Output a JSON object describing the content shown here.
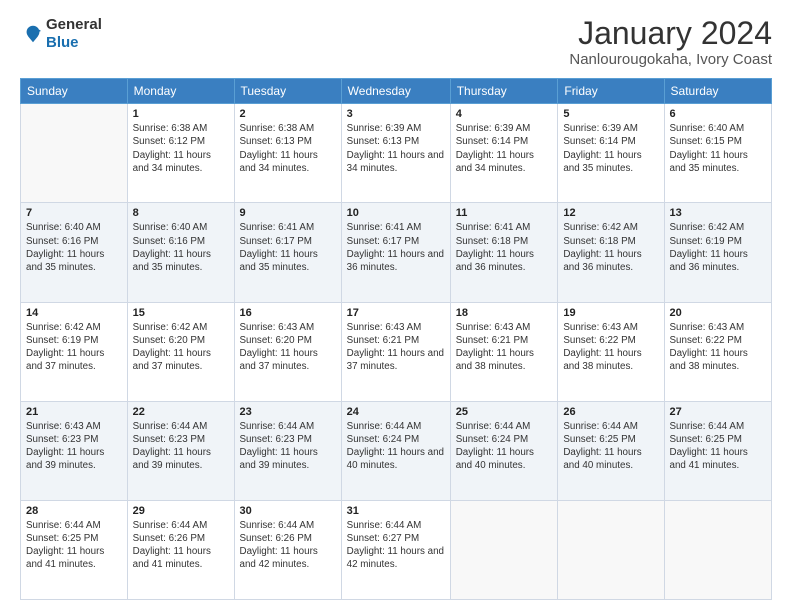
{
  "logo": {
    "general": "General",
    "blue": "Blue"
  },
  "title": "January 2024",
  "subtitle": "Nanlourougokaha, Ivory Coast",
  "header_days": [
    "Sunday",
    "Monday",
    "Tuesday",
    "Wednesday",
    "Thursday",
    "Friday",
    "Saturday"
  ],
  "weeks": [
    [
      {
        "day": "",
        "sunrise": "",
        "sunset": "",
        "daylight": ""
      },
      {
        "day": "1",
        "sunrise": "Sunrise: 6:38 AM",
        "sunset": "Sunset: 6:12 PM",
        "daylight": "Daylight: 11 hours and 34 minutes."
      },
      {
        "day": "2",
        "sunrise": "Sunrise: 6:38 AM",
        "sunset": "Sunset: 6:13 PM",
        "daylight": "Daylight: 11 hours and 34 minutes."
      },
      {
        "day": "3",
        "sunrise": "Sunrise: 6:39 AM",
        "sunset": "Sunset: 6:13 PM",
        "daylight": "Daylight: 11 hours and 34 minutes."
      },
      {
        "day": "4",
        "sunrise": "Sunrise: 6:39 AM",
        "sunset": "Sunset: 6:14 PM",
        "daylight": "Daylight: 11 hours and 34 minutes."
      },
      {
        "day": "5",
        "sunrise": "Sunrise: 6:39 AM",
        "sunset": "Sunset: 6:14 PM",
        "daylight": "Daylight: 11 hours and 35 minutes."
      },
      {
        "day": "6",
        "sunrise": "Sunrise: 6:40 AM",
        "sunset": "Sunset: 6:15 PM",
        "daylight": "Daylight: 11 hours and 35 minutes."
      }
    ],
    [
      {
        "day": "7",
        "sunrise": "Sunrise: 6:40 AM",
        "sunset": "Sunset: 6:16 PM",
        "daylight": "Daylight: 11 hours and 35 minutes."
      },
      {
        "day": "8",
        "sunrise": "Sunrise: 6:40 AM",
        "sunset": "Sunset: 6:16 PM",
        "daylight": "Daylight: 11 hours and 35 minutes."
      },
      {
        "day": "9",
        "sunrise": "Sunrise: 6:41 AM",
        "sunset": "Sunset: 6:17 PM",
        "daylight": "Daylight: 11 hours and 35 minutes."
      },
      {
        "day": "10",
        "sunrise": "Sunrise: 6:41 AM",
        "sunset": "Sunset: 6:17 PM",
        "daylight": "Daylight: 11 hours and 36 minutes."
      },
      {
        "day": "11",
        "sunrise": "Sunrise: 6:41 AM",
        "sunset": "Sunset: 6:18 PM",
        "daylight": "Daylight: 11 hours and 36 minutes."
      },
      {
        "day": "12",
        "sunrise": "Sunrise: 6:42 AM",
        "sunset": "Sunset: 6:18 PM",
        "daylight": "Daylight: 11 hours and 36 minutes."
      },
      {
        "day": "13",
        "sunrise": "Sunrise: 6:42 AM",
        "sunset": "Sunset: 6:19 PM",
        "daylight": "Daylight: 11 hours and 36 minutes."
      }
    ],
    [
      {
        "day": "14",
        "sunrise": "Sunrise: 6:42 AM",
        "sunset": "Sunset: 6:19 PM",
        "daylight": "Daylight: 11 hours and 37 minutes."
      },
      {
        "day": "15",
        "sunrise": "Sunrise: 6:42 AM",
        "sunset": "Sunset: 6:20 PM",
        "daylight": "Daylight: 11 hours and 37 minutes."
      },
      {
        "day": "16",
        "sunrise": "Sunrise: 6:43 AM",
        "sunset": "Sunset: 6:20 PM",
        "daylight": "Daylight: 11 hours and 37 minutes."
      },
      {
        "day": "17",
        "sunrise": "Sunrise: 6:43 AM",
        "sunset": "Sunset: 6:21 PM",
        "daylight": "Daylight: 11 hours and 37 minutes."
      },
      {
        "day": "18",
        "sunrise": "Sunrise: 6:43 AM",
        "sunset": "Sunset: 6:21 PM",
        "daylight": "Daylight: 11 hours and 38 minutes."
      },
      {
        "day": "19",
        "sunrise": "Sunrise: 6:43 AM",
        "sunset": "Sunset: 6:22 PM",
        "daylight": "Daylight: 11 hours and 38 minutes."
      },
      {
        "day": "20",
        "sunrise": "Sunrise: 6:43 AM",
        "sunset": "Sunset: 6:22 PM",
        "daylight": "Daylight: 11 hours and 38 minutes."
      }
    ],
    [
      {
        "day": "21",
        "sunrise": "Sunrise: 6:43 AM",
        "sunset": "Sunset: 6:23 PM",
        "daylight": "Daylight: 11 hours and 39 minutes."
      },
      {
        "day": "22",
        "sunrise": "Sunrise: 6:44 AM",
        "sunset": "Sunset: 6:23 PM",
        "daylight": "Daylight: 11 hours and 39 minutes."
      },
      {
        "day": "23",
        "sunrise": "Sunrise: 6:44 AM",
        "sunset": "Sunset: 6:23 PM",
        "daylight": "Daylight: 11 hours and 39 minutes."
      },
      {
        "day": "24",
        "sunrise": "Sunrise: 6:44 AM",
        "sunset": "Sunset: 6:24 PM",
        "daylight": "Daylight: 11 hours and 40 minutes."
      },
      {
        "day": "25",
        "sunrise": "Sunrise: 6:44 AM",
        "sunset": "Sunset: 6:24 PM",
        "daylight": "Daylight: 11 hours and 40 minutes."
      },
      {
        "day": "26",
        "sunrise": "Sunrise: 6:44 AM",
        "sunset": "Sunset: 6:25 PM",
        "daylight": "Daylight: 11 hours and 40 minutes."
      },
      {
        "day": "27",
        "sunrise": "Sunrise: 6:44 AM",
        "sunset": "Sunset: 6:25 PM",
        "daylight": "Daylight: 11 hours and 41 minutes."
      }
    ],
    [
      {
        "day": "28",
        "sunrise": "Sunrise: 6:44 AM",
        "sunset": "Sunset: 6:25 PM",
        "daylight": "Daylight: 11 hours and 41 minutes."
      },
      {
        "day": "29",
        "sunrise": "Sunrise: 6:44 AM",
        "sunset": "Sunset: 6:26 PM",
        "daylight": "Daylight: 11 hours and 41 minutes."
      },
      {
        "day": "30",
        "sunrise": "Sunrise: 6:44 AM",
        "sunset": "Sunset: 6:26 PM",
        "daylight": "Daylight: 11 hours and 42 minutes."
      },
      {
        "day": "31",
        "sunrise": "Sunrise: 6:44 AM",
        "sunset": "Sunset: 6:27 PM",
        "daylight": "Daylight: 11 hours and 42 minutes."
      },
      {
        "day": "",
        "sunrise": "",
        "sunset": "",
        "daylight": ""
      },
      {
        "day": "",
        "sunrise": "",
        "sunset": "",
        "daylight": ""
      },
      {
        "day": "",
        "sunrise": "",
        "sunset": "",
        "daylight": ""
      }
    ]
  ]
}
